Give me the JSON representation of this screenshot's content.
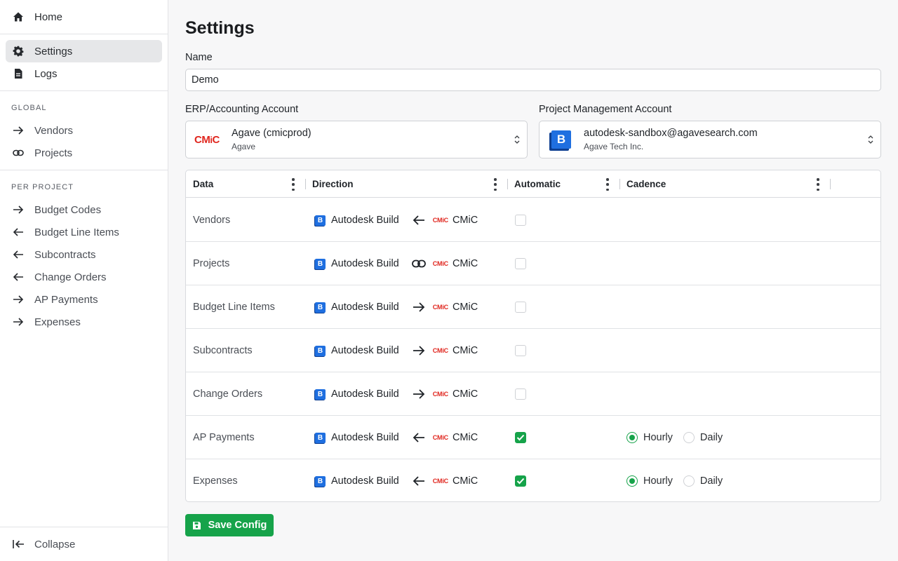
{
  "sidebar": {
    "top_items": [
      {
        "label": "Home",
        "icon": "home-icon"
      },
      {
        "label": "Settings",
        "icon": "gear-icon",
        "active": true
      },
      {
        "label": "Logs",
        "icon": "document-icon"
      }
    ],
    "global_label": "GLOBAL",
    "global_items": [
      {
        "label": "Vendors",
        "icon": "arrow-right-icon"
      },
      {
        "label": "Projects",
        "icon": "link-icon"
      }
    ],
    "per_project_label": "PER PROJECT",
    "per_project_items": [
      {
        "label": "Budget Codes",
        "icon": "arrow-right-icon"
      },
      {
        "label": "Budget Line Items",
        "icon": "arrow-left-icon"
      },
      {
        "label": "Subcontracts",
        "icon": "arrow-left-icon"
      },
      {
        "label": "Change Orders",
        "icon": "arrow-left-icon"
      },
      {
        "label": "AP Payments",
        "icon": "arrow-right-icon"
      },
      {
        "label": "Expenses",
        "icon": "arrow-right-icon"
      }
    ],
    "collapse_label": "Collapse"
  },
  "page": {
    "title": "Settings",
    "name_label": "Name",
    "name_value": "Demo",
    "erp_label": "ERP/Accounting Account",
    "erp_logo": "CM",
    "erp_logo_i": "i",
    "erp_logo_c": "C",
    "erp_title": "Agave (cmicprod)",
    "erp_sub": "Agave",
    "pm_label": "Project Management Account",
    "pm_logo": "B",
    "pm_title": "autodesk-sandbox@agavesearch.com",
    "pm_sub": "Agave Tech Inc."
  },
  "table": {
    "headers": {
      "data": "Data",
      "direction": "Direction",
      "automatic": "Automatic",
      "cadence": "Cadence"
    },
    "target": "Autodesk Build",
    "target_logo": "B",
    "source": "CMiC",
    "source_logo": "CMiC",
    "rows": [
      {
        "name": "Vendors",
        "direction": "arrow-left-icon",
        "automatic": false
      },
      {
        "name": "Projects",
        "direction": "link-icon",
        "automatic": false
      },
      {
        "name": "Budget Line Items",
        "direction": "arrow-right-icon",
        "automatic": false
      },
      {
        "name": "Subcontracts",
        "direction": "arrow-right-icon",
        "automatic": false
      },
      {
        "name": "Change Orders",
        "direction": "arrow-right-icon",
        "automatic": false
      },
      {
        "name": "AP Payments",
        "direction": "arrow-left-icon",
        "automatic": true,
        "cadence": {
          "options": [
            "Hourly",
            "Daily"
          ],
          "selected": "Hourly"
        }
      },
      {
        "name": "Expenses",
        "direction": "arrow-left-icon",
        "automatic": true,
        "cadence": {
          "options": [
            "Hourly",
            "Daily"
          ],
          "selected": "Hourly"
        }
      }
    ]
  },
  "save_label": "Save Config",
  "colors": {
    "accent": "#16a34a",
    "cmic_red": "#e0261e",
    "autodesk_blue": "#1f6fe0"
  }
}
